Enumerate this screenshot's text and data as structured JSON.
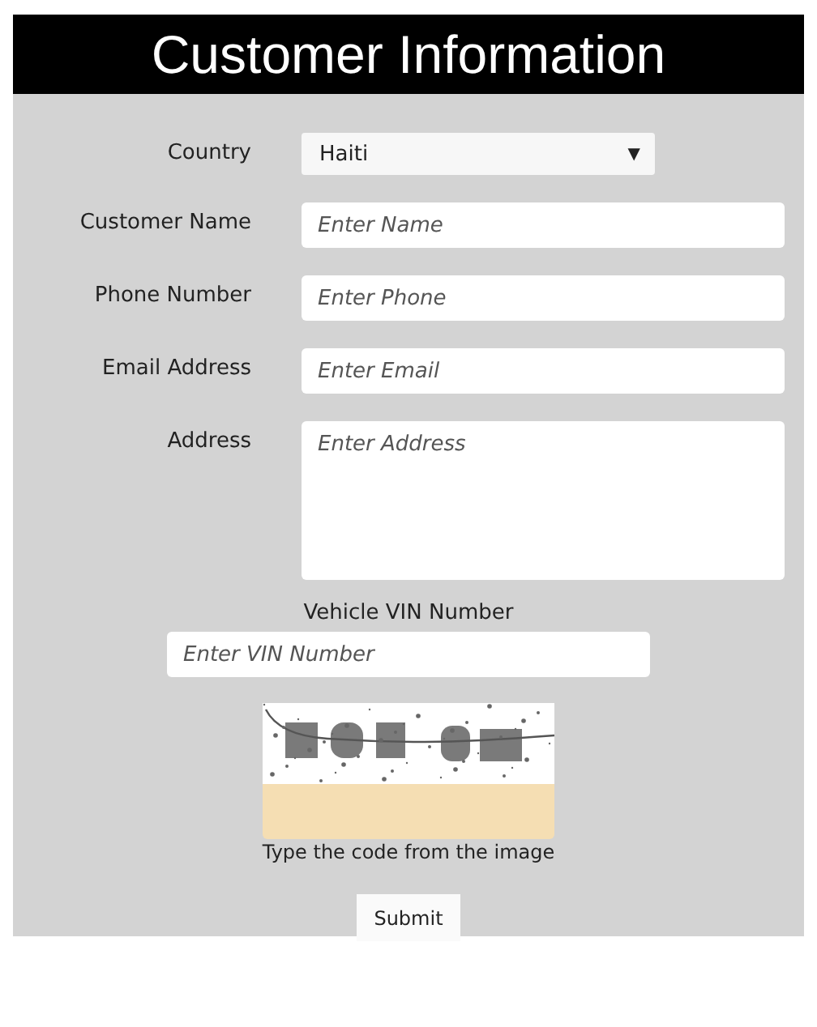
{
  "title": "Customer Information",
  "country": {
    "label": "Country",
    "value": "Haiti",
    "arrow": "▼"
  },
  "fields": [
    {
      "label": "Customer Name",
      "placeholder": "Enter Name",
      "kind": "line"
    },
    {
      "label": "Phone Number",
      "placeholder": "Enter Phone",
      "kind": "line"
    },
    {
      "label": "Email Address",
      "placeholder": "Enter Email",
      "kind": "line"
    },
    {
      "label": "Address",
      "placeholder": "Enter Address",
      "kind": "area"
    }
  ],
  "vin": {
    "label": "Vehicle VIN Number",
    "placeholder": "Enter VIN Number"
  },
  "captcha": {
    "kind": "picture",
    "caption": "Type the code from the image"
  },
  "submit": "Submit"
}
